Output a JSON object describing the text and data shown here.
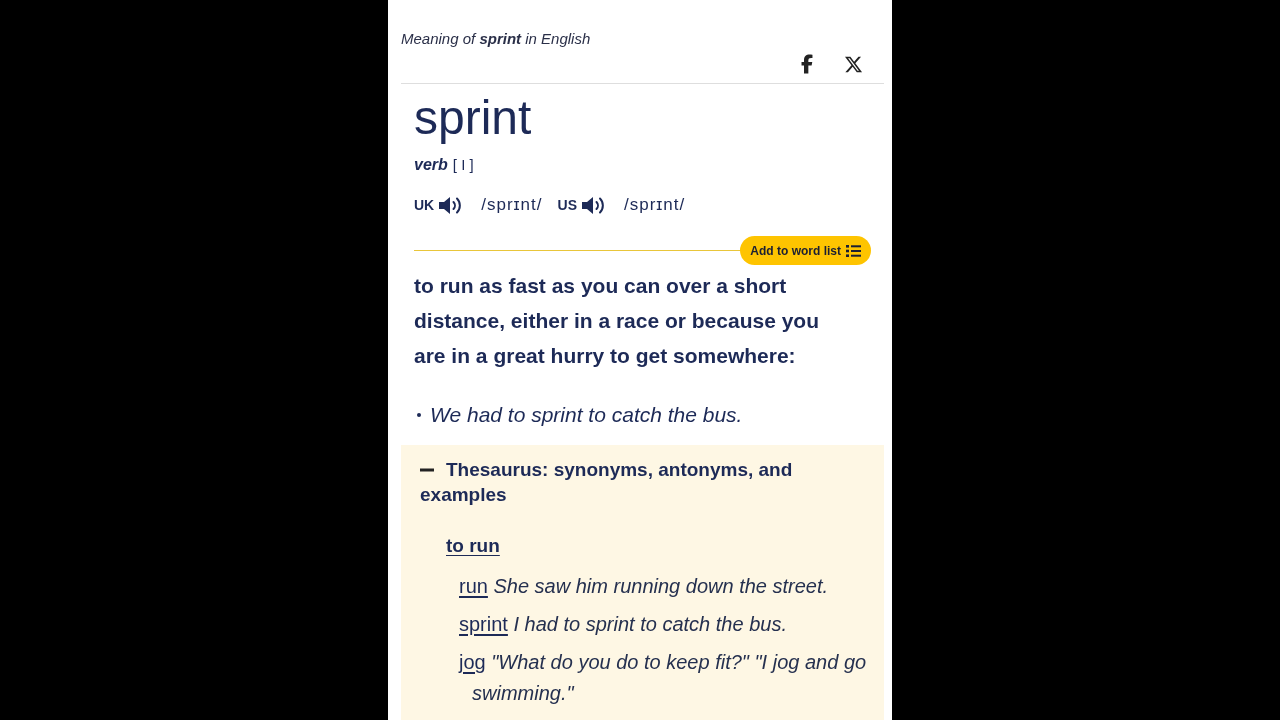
{
  "header": {
    "meaning": "Meaning of **sprint** in English"
  },
  "entry": {
    "headword": "sprint",
    "part_of_speech": "verb",
    "grammar": "[ I ]",
    "pronunciations": [
      {
        "region": "UK",
        "ipa": "/sprɪnt/"
      },
      {
        "region": "US",
        "ipa": "/sprɪnt/"
      }
    ],
    "add_button": "Add to word list"
  },
  "sense": {
    "definition": "to run as fast as you can over a short distance, either in a race or because you are in a great hurry to get somewhere:",
    "examples": [
      "We had to sprint to catch the bus."
    ]
  },
  "thesaurus": {
    "title": "Thesaurus: synonyms, antonyms, and examples",
    "expanded": true,
    "groups": [
      {
        "heading": "to run",
        "items": [
          {
            "word": "run",
            "example": "She saw him running down the street."
          },
          {
            "word": "sprint",
            "example": "I had to sprint to catch the bus."
          },
          {
            "word": "jog",
            "example": "\"What do you do to keep fit?\" \"I jog and go swimming.\""
          }
        ]
      }
    ]
  }
}
